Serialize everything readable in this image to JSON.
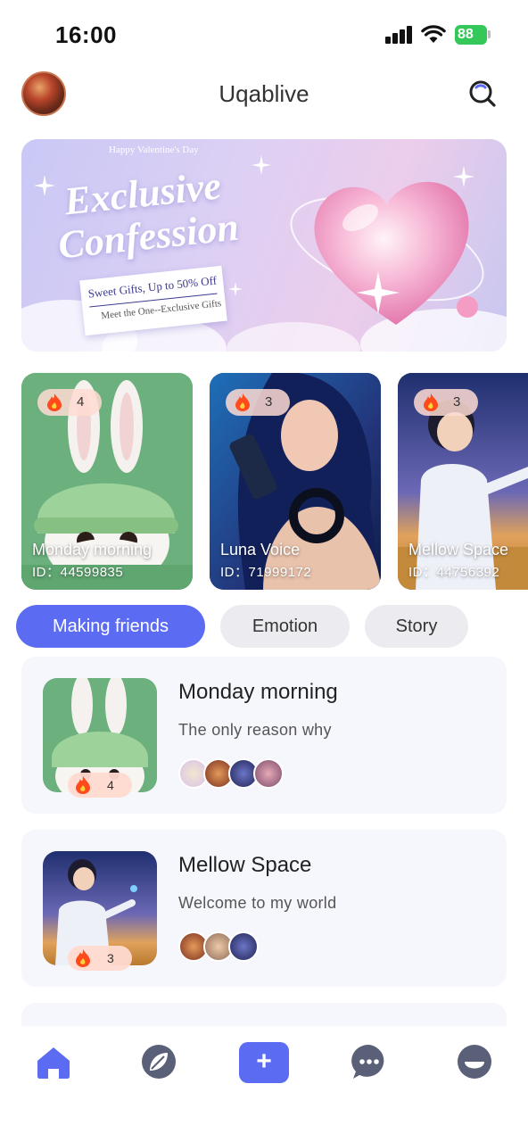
{
  "status_bar": {
    "time": "16:00",
    "battery": "88"
  },
  "header": {
    "title": "Uqablive"
  },
  "banner": {
    "small_text": "Happy Valentine's Day",
    "headline_line1": "Exclusive",
    "headline_line2": "Confession",
    "note_line1": "Sweet Gifts, Up to 50% Off",
    "note_line2": "Meet the One--Exclusive Gifts"
  },
  "live_rooms": [
    {
      "name": "Monday morning",
      "id": "ID：44599835",
      "heat": "4",
      "icon": "bunny-image"
    },
    {
      "name": "Luna Voice",
      "id": "ID：71999172",
      "heat": "3",
      "icon": "singer-image"
    },
    {
      "name": "Mellow Space",
      "id": "ID：44756392",
      "heat": "3",
      "icon": "boy-field-image"
    }
  ],
  "tabs": [
    {
      "label": "Making friends",
      "active": true
    },
    {
      "label": "Emotion",
      "active": false
    },
    {
      "label": "Story",
      "active": false
    }
  ],
  "room_list": [
    {
      "title": "Monday morning",
      "desc": "The only reason why",
      "heat": "4"
    },
    {
      "title": "Mellow Space",
      "desc": "Welcome to my world",
      "heat": "3"
    }
  ],
  "bottom_nav": {
    "items": [
      "home-icon",
      "explore-icon",
      "add-icon",
      "messages-icon",
      "profile-icon"
    ],
    "add_label": "+"
  },
  "colors": {
    "accent": "#5b6cf2",
    "battery": "#34c759",
    "heat_bg": "#ffdad0"
  }
}
